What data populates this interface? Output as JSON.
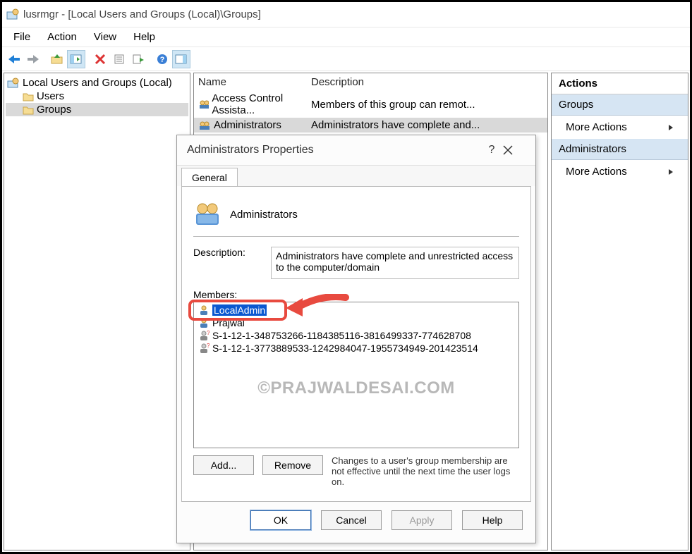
{
  "titlebar": {
    "text": "lusrmgr - [Local Users and Groups (Local)\\Groups]"
  },
  "menubar": {
    "items": [
      "File",
      "Action",
      "View",
      "Help"
    ]
  },
  "tree": {
    "root": "Local Users and Groups (Local)",
    "children": [
      {
        "label": "Users"
      },
      {
        "label": "Groups",
        "selected": true
      }
    ]
  },
  "list": {
    "columns": [
      "Name",
      "Description"
    ],
    "rows": [
      {
        "name": "Access Control Assista...",
        "desc": "Members of this group can remot..."
      },
      {
        "name": "Administrators",
        "desc": "Administrators have complete and...",
        "selected": true
      }
    ]
  },
  "actions": {
    "header": "Actions",
    "sections": [
      {
        "title": "Groups",
        "items": [
          "More Actions"
        ]
      },
      {
        "title": "Administrators",
        "items": [
          "More Actions"
        ]
      }
    ]
  },
  "dialog": {
    "title": "Administrators Properties",
    "tab": "General",
    "group_name": "Administrators",
    "desc_label": "Description:",
    "description": "Administrators have complete and unrestricted access to the computer/domain",
    "members_label": "Members:",
    "members": [
      {
        "name": "LocalAdmin",
        "selected": true,
        "highlighted": true
      },
      {
        "name": "Prajwal"
      },
      {
        "name": "S-1-12-1-348753266-1184385116-3816499337-774628708"
      },
      {
        "name": "S-1-12-1-3773889533-1242984047-1955734949-201423514"
      }
    ],
    "watermark": "©PRAJWALDESAI.COM",
    "buttons": {
      "add": "Add...",
      "remove": "Remove"
    },
    "note": "Changes to a user's group membership are not effective until the next time the user logs on.",
    "footer": {
      "ok": "OK",
      "cancel": "Cancel",
      "apply": "Apply",
      "help": "Help"
    }
  }
}
